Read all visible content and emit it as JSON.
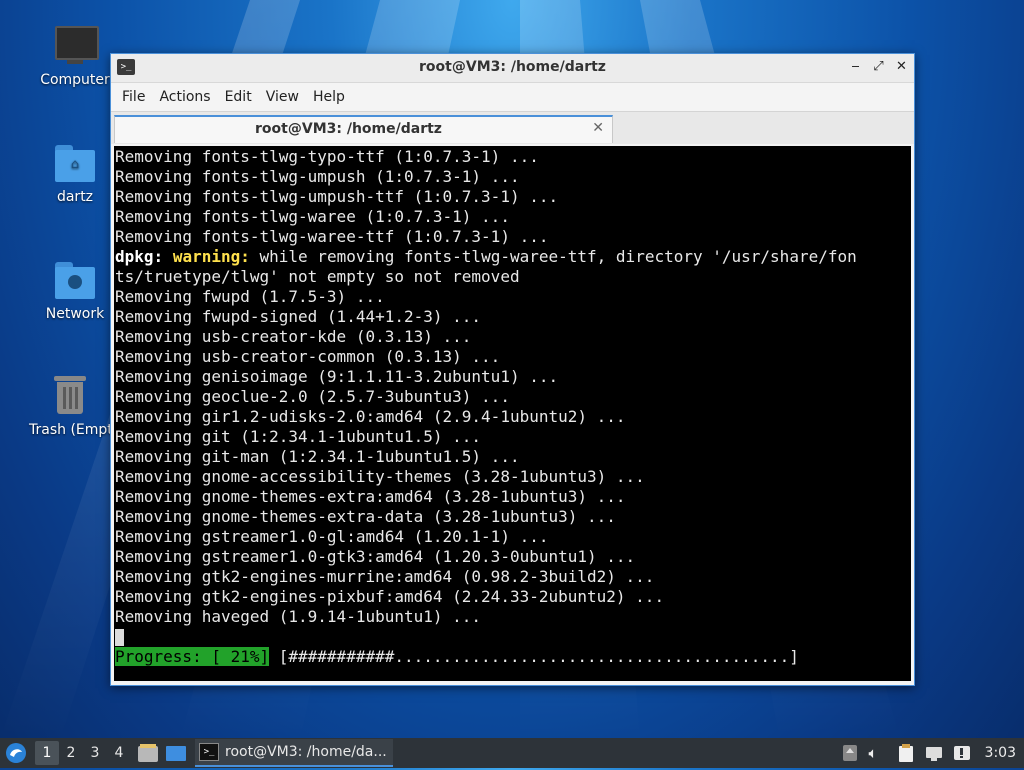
{
  "desktop": {
    "icons": [
      {
        "label": "Computer"
      },
      {
        "label": "dartz"
      },
      {
        "label": "Network"
      },
      {
        "label": "Trash (Empty)"
      }
    ]
  },
  "window": {
    "title": "root@VM3: /home/dartz",
    "menu": [
      "File",
      "Actions",
      "Edit",
      "View",
      "Help"
    ],
    "tab_title": "root@VM3: /home/dartz"
  },
  "terminal": {
    "lines": [
      "Removing fonts-tlwg-typo-ttf (1:0.7.3-1) ...",
      "Removing fonts-tlwg-umpush (1:0.7.3-1) ...",
      "Removing fonts-tlwg-umpush-ttf (1:0.7.3-1) ...",
      "Removing fonts-tlwg-waree (1:0.7.3-1) ...",
      "Removing fonts-tlwg-waree-ttf (1:0.7.3-1) ..."
    ],
    "warning": {
      "prefix": "dpkg:",
      "keyword": "warning:",
      "text1": " while removing fonts-tlwg-waree-ttf, directory '/usr/share/fon",
      "text2": "ts/truetype/tlwg' not empty so not removed"
    },
    "lines2": [
      "Removing fwupd (1.7.5-3) ...",
      "Removing fwupd-signed (1.44+1.2-3) ...",
      "Removing usb-creator-kde (0.3.13) ...",
      "Removing usb-creator-common (0.3.13) ...",
      "Removing genisoimage (9:1.1.11-3.2ubuntu1) ...",
      "Removing geoclue-2.0 (2.5.7-3ubuntu3) ...",
      "Removing gir1.2-udisks-2.0:amd64 (2.9.4-1ubuntu2) ...",
      "Removing git (1:2.34.1-1ubuntu1.5) ...",
      "Removing git-man (1:2.34.1-1ubuntu1.5) ...",
      "Removing gnome-accessibility-themes (3.28-1ubuntu3) ...",
      "Removing gnome-themes-extra:amd64 (3.28-1ubuntu3) ...",
      "Removing gnome-themes-extra-data (3.28-1ubuntu3) ...",
      "Removing gstreamer1.0-gl:amd64 (1.20.1-1) ...",
      "Removing gstreamer1.0-gtk3:amd64 (1.20.3-0ubuntu1) ...",
      "Removing gtk2-engines-murrine:amd64 (0.98.2-3build2) ...",
      "Removing gtk2-engines-pixbuf:amd64 (2.24.33-2ubuntu2) ...",
      "Removing haveged (1.9.14-1ubuntu1) ..."
    ],
    "progress_label": "Progress: [ 21%]",
    "progress_bar": " [###########.........................................]",
    "progress_percent": 21
  },
  "taskbar": {
    "workspaces": [
      "1",
      "2",
      "3",
      "4"
    ],
    "active_workspace": "1",
    "task_title": "root@VM3: /home/da...",
    "clock": "3:03"
  },
  "colors": {
    "accent": "#4a90d9",
    "progress_green": "#22a22a",
    "warning_yellow": "#ffe14d",
    "taskbar_bg": "#2d3339"
  }
}
